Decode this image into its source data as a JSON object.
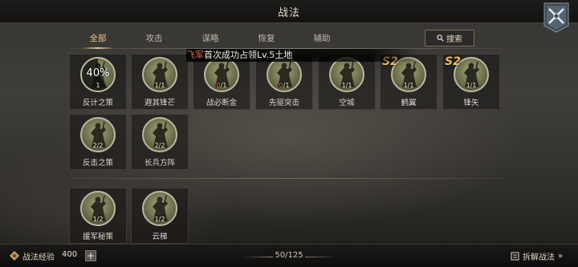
{
  "header": {
    "title": "战法"
  },
  "tabs": [
    {
      "label": "全部",
      "active": true
    },
    {
      "label": "攻击"
    },
    {
      "label": "谋略"
    },
    {
      "label": "恢复"
    },
    {
      "label": "辅助"
    }
  ],
  "search": {
    "label": "搜索",
    "icon": "search-icon"
  },
  "notification": {
    "highlight": "飞军",
    "text": "首次成功占领Lv.5土地"
  },
  "tactics_row1": [
    {
      "name": "反计之策",
      "progress_label": "40%",
      "progress": 0.4,
      "level": "1"
    },
    {
      "name": "避其锋芒",
      "level": "1/1"
    },
    {
      "name": "战必断金",
      "level_red": "0",
      "level_max": "/1"
    },
    {
      "name": "先驱突击",
      "level_red": "0",
      "level_max": "/1"
    },
    {
      "name": "空城",
      "level": "1/1"
    },
    {
      "name": "鹤翼",
      "badge": "S2",
      "level": "1/1"
    },
    {
      "name": "锋矢",
      "badge": "S2",
      "level": "1/1"
    }
  ],
  "tactics_row2": [
    {
      "name": "反击之策",
      "level": "2/2"
    },
    {
      "name": "长兵方阵",
      "level": "2/2"
    }
  ],
  "tactics_row3": [
    {
      "name": "援军秘策",
      "level": "1/2"
    },
    {
      "name": "云梯",
      "level": "1/2"
    }
  ],
  "footer": {
    "exp_label": "战法经验",
    "exp_value": "400",
    "plus": "+",
    "count": "50/125",
    "dismantle_label": "拆解战法"
  },
  "colors": {
    "accent": "#e8c78a",
    "badge": "#e6bd66",
    "warn": "#e06050"
  }
}
